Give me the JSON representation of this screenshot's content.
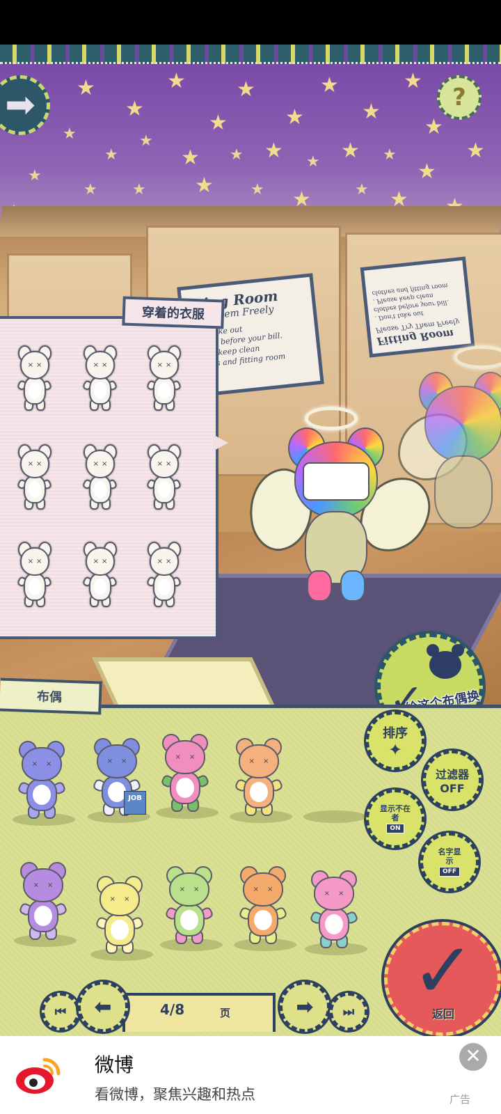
{
  "scene": {
    "sign_left": {
      "title": "tting Room",
      "subtitle": "Try Them Freely",
      "line1": "on't take out",
      "line2": "lothes before your bill.",
      "line3": "lease keep clean",
      "line4": "lothes and fitting room"
    },
    "sign_right": {
      "title": "Fitting Room",
      "subtitle": "Please Try Them Freely",
      "line1": ". Don't take out",
      "line2": "clothes before your bill.",
      "line3": ". Please keep clean",
      "line4": "clothes and fitting room"
    }
  },
  "buttons": {
    "help_label": "?",
    "give_clothes_label": "给这个布偶换衣服",
    "sort_label": "排序",
    "filter_label": "过滤器",
    "filter_state": "OFF",
    "show_absent_label": "显示不在者",
    "show_absent_state": "ON",
    "show_names_label": "名字显示",
    "show_names_state": "OFF",
    "return_label": "返回"
  },
  "clothes_panel": {
    "title": "穿着的衣服"
  },
  "dolls_panel": {
    "title": "布偶",
    "job_badge": "JOB"
  },
  "pager": {
    "page": "4/8",
    "unit": "页"
  },
  "ad": {
    "title": "微博",
    "description": "看微博，聚焦兴趣和热点",
    "tag": "广告"
  },
  "colors": {
    "wallpaper": "#7a4aa8",
    "panel_navy": "#2e4060",
    "doll_panel": "#d6dd8c",
    "clothes_panel": "#f2dfe3",
    "return_red": "#e5595a"
  }
}
